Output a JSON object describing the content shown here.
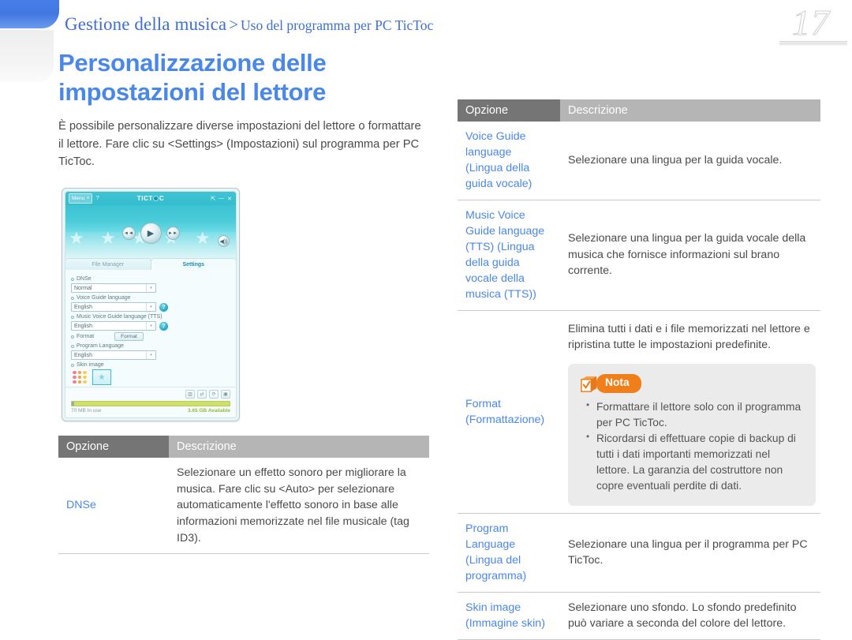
{
  "header": {
    "breadcrumb_main": "Gestione della musica",
    "breadcrumb_separator": ">",
    "breadcrumb_sub": "Uso del programma per PC TicToc",
    "page_number": "17"
  },
  "main": {
    "title_line1": "Personalizzazione delle",
    "title_line2": "impostazioni del lettore",
    "intro": "È possibile personalizzare diverse impostazioni del lettore o formattare il lettore. Fare clic su <Settings> (Impostazioni) sul programma per PC TicToc."
  },
  "app_screenshot": {
    "menu_label": "Menu",
    "menu_caret": "▾",
    "help_label": "?",
    "logo_left": "TICT",
    "logo_right": "C",
    "ctrl_pin": "⇱",
    "ctrl_min": "—",
    "ctrl_close": "✕",
    "btn_prev": "◄◄",
    "btn_play": "▶",
    "btn_next": "►►",
    "btn_speaker": "🔊",
    "tab_file_manager": "File Manager",
    "tab_settings": "Settings",
    "label_dnse": "DNSe",
    "value_dnse": "Normal",
    "label_voice_guide": "Voice Guide language",
    "value_voice_guide": "English",
    "label_music_voice_guide": "Music Voice Guide language (TTS)",
    "value_music_voice_guide": "English",
    "label_format": "Format",
    "button_format": "Format",
    "label_program_language": "Program Language",
    "value_program_language": "English",
    "label_skin_image": "Skin image",
    "help_badge": "?",
    "combo_arrow": "▾",
    "footer_icons": [
      "▥",
      "⇄",
      "⟳",
      "▣"
    ],
    "storage_in_use": "70 MB In use",
    "storage_available": "3.65 GB Available"
  },
  "table_left": {
    "headers": {
      "option": "Opzione",
      "description": "Descrizione"
    },
    "rows": [
      {
        "option": "DNSe",
        "description": "Selezionare un effetto sonoro per migliorare la musica. Fare clic su <Auto> per selezionare automaticamente l'effetto sonoro in base alle informazioni memorizzate nel file musicale (tag ID3)."
      }
    ]
  },
  "table_right": {
    "headers": {
      "option": "Opzione",
      "description": "Descrizione"
    },
    "rows": [
      {
        "option_line1": "Voice Guide",
        "option_line2": "language",
        "option_line3": "(Lingua della",
        "option_line4": "guida vocale)",
        "description": "Selezionare una lingua per la guida vocale."
      },
      {
        "option_line1": "Music Voice",
        "option_line2": "Guide language",
        "option_line3": "(TTS) (Lingua",
        "option_line4": "della guida",
        "option_line5": "vocale della",
        "option_line6": "musica (TTS))",
        "description": "Selezionare una lingua per la guida vocale della musica che fornisce informazioni sul brano corrente."
      },
      {
        "option_line1": "Format",
        "option_line2": "(Formattazione)",
        "description": "Elimina tutti i dati e i file memorizzati nel lettore e ripristina tutte le impostazioni predefinite.",
        "note": {
          "badge": "Nota",
          "items": [
            "Formattare il lettore solo con il programma per PC TicToc.",
            "Ricordarsi di effettuare copie di backup di tutti i dati importanti memorizzati nel lettore. La garanzia del costruttore non copre eventuali perdite di dati."
          ]
        }
      },
      {
        "option_line1": "Program",
        "option_line2": "Language",
        "option_line3": "(Lingua del",
        "option_line4": "programma)",
        "description": "Selezionare una lingua per il programma per PC TicToc."
      },
      {
        "option_line1": "Skin image",
        "option_line2": "(Immagine skin)",
        "description": "Selezionare uno sfondo. Lo sfondo predefinito può variare a seconda del colore del lettore."
      }
    ]
  },
  "colors": {
    "accent_blue": "#4a88e8",
    "header_dark_gray": "#757575",
    "header_light_gray": "#b5b5b5",
    "note_orange": "#f07f1a",
    "note_bg": "#ebebeb",
    "app_teal": "#3fc4d4"
  }
}
